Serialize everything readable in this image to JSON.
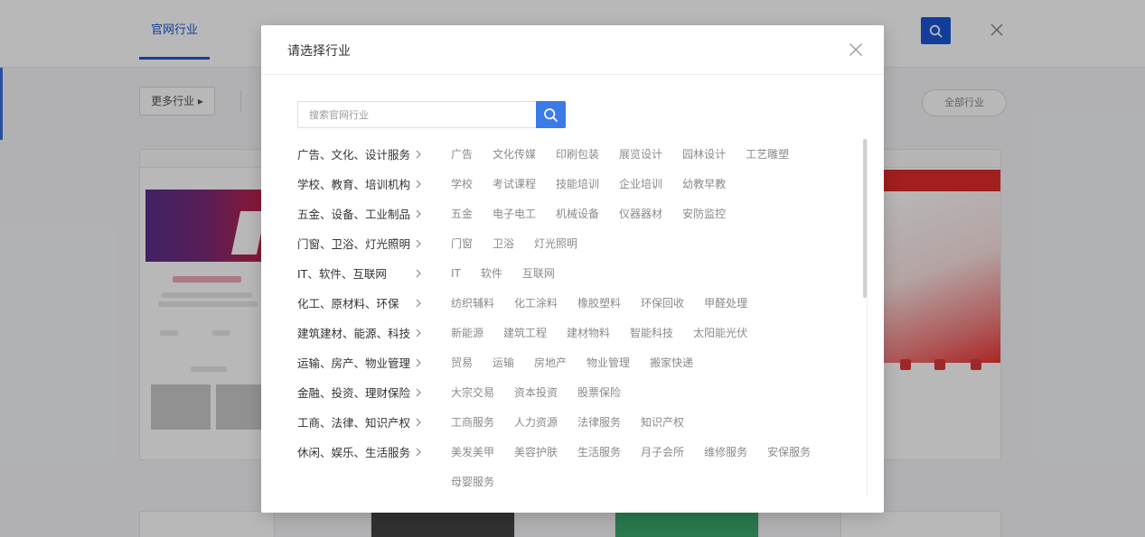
{
  "background": {
    "tab_label": "官网行业",
    "filter_left_label": "更多行业 ▸",
    "filter_right_label": "全部行业"
  },
  "modal": {
    "title": "请选择行业",
    "search_placeholder": "搜索官网行业",
    "search_value": "",
    "accent_color": "#3b7ae8",
    "industries": [
      {
        "label": "广告、文化、设计服务",
        "subs": [
          "广告",
          "文化传媒",
          "印刷包装",
          "展览设计",
          "园林设计",
          "工艺雕塑"
        ]
      },
      {
        "label": "学校、教育、培训机构",
        "subs": [
          "学校",
          "考试课程",
          "技能培训",
          "企业培训",
          "幼教早教"
        ]
      },
      {
        "label": "五金、设备、工业制品",
        "subs": [
          "五金",
          "电子电工",
          "机械设备",
          "仪器器材",
          "安防监控"
        ]
      },
      {
        "label": "门窗、卫浴、灯光照明",
        "subs": [
          "门窗",
          "卫浴",
          "灯光照明"
        ]
      },
      {
        "label": "IT、软件、互联网",
        "subs": [
          "IT",
          "软件",
          "互联网"
        ]
      },
      {
        "label": "化工、原材料、环保",
        "subs": [
          "纺织辅料",
          "化工涂料",
          "橡胶塑料",
          "环保回收",
          "甲醛处理"
        ]
      },
      {
        "label": "建筑建材、能源、科技",
        "subs": [
          "新能源",
          "建筑工程",
          "建材物料",
          "智能科技",
          "太阳能光伏"
        ]
      },
      {
        "label": "运输、房产、物业管理",
        "subs": [
          "贸易",
          "运输",
          "房地产",
          "物业管理",
          "搬家快递"
        ]
      },
      {
        "label": "金融、投资、理财保险",
        "subs": [
          "大宗交易",
          "资本投资",
          "股票保险"
        ]
      },
      {
        "label": "工商、法律、知识产权",
        "subs": [
          "工商服务",
          "人力资源",
          "法律服务",
          "知识产权"
        ]
      },
      {
        "label": "休闲、娱乐、生活服务",
        "subs": [
          "美发美甲",
          "美容护肤",
          "生活服务",
          "月子会所",
          "维修服务",
          "安保服务",
          "母婴服务"
        ]
      }
    ]
  }
}
